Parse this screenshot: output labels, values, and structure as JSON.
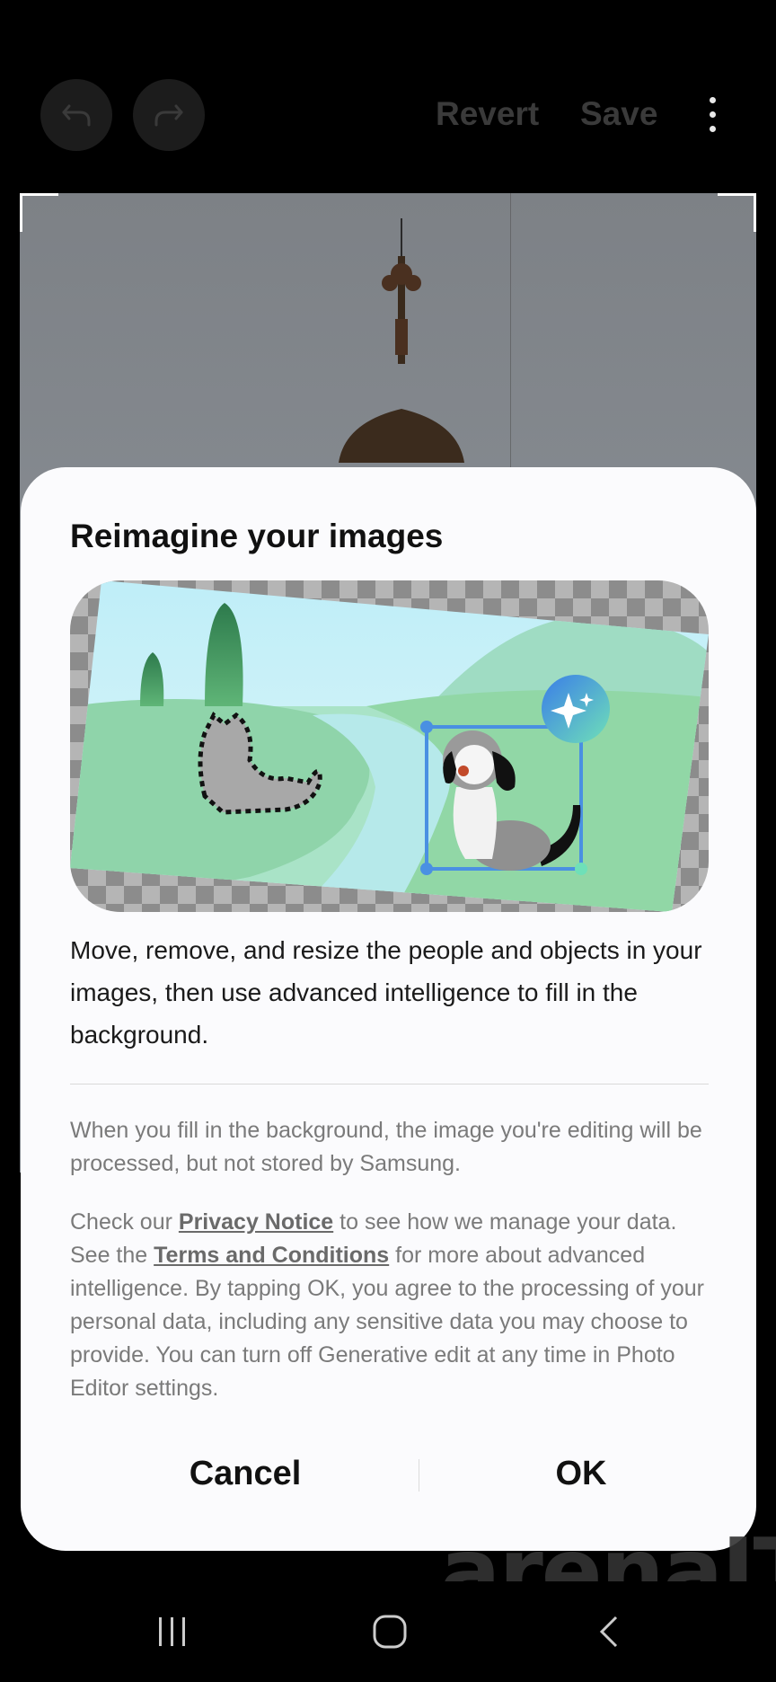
{
  "topbar": {
    "revert_label": "Revert",
    "save_label": "Save"
  },
  "dialog": {
    "title": "Reimagine your images",
    "description": "Move, remove, and resize the people and objects in your images, then use advanced intelligence to fill in the background.",
    "notice1": "When you fill in the background, the image you're editing will be processed, but not stored by Samsung.",
    "notice2_pre": "Check our ",
    "privacy_link": "Privacy Notice",
    "notice2_mid": " to see how we manage your data. See the ",
    "terms_link": "Terms and Conditions",
    "notice2_post": " for more about advanced intelligence. By tapping OK, you agree to the processing of your personal data, including any sensitive data you may choose to provide. You can turn off Generative edit at any time in Photo Editor settings.",
    "cancel_label": "Cancel",
    "ok_label": "OK"
  },
  "watermark": {
    "text": "arenaIT"
  },
  "colors": {
    "dialog_bg": "#fbfbfd",
    "accent_blue": "#4a90e2"
  }
}
